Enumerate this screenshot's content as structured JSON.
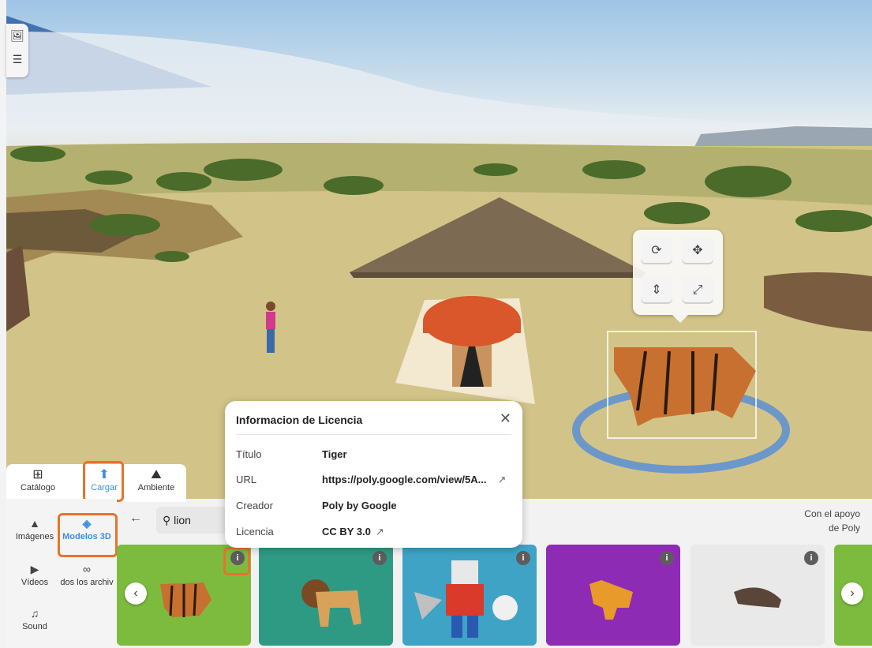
{
  "side_tools": {
    "gallery_icon": "gallery-icon",
    "list_icon": "list-icon"
  },
  "gizmo": {
    "rotate_icon": "rotate-icon",
    "move_icon": "move-icon",
    "height_icon": "height-icon",
    "scale_icon": "scale-icon"
  },
  "tabs": [
    {
      "label": "Catálogo",
      "icon": "⊞"
    },
    {
      "label": "Cargar",
      "icon": "⬆"
    },
    {
      "label": "Ambiente",
      "icon": "⛰"
    }
  ],
  "nav": [
    {
      "label": "Imágenes",
      "icon": "▲"
    },
    {
      "label": "Modelos 3D",
      "icon": "◈"
    },
    {
      "label": "Vídeos",
      "icon": "▶"
    },
    {
      "label": "dos los archiv",
      "icon": "∞"
    },
    {
      "label": "Sound",
      "icon": "♫"
    }
  ],
  "search": {
    "value": "lion"
  },
  "support": {
    "line1": "Con el apoyo",
    "line2": "de Poly"
  },
  "popup": {
    "title": "Informacion de Licencia",
    "close": "✕",
    "rows": [
      {
        "key": "Título",
        "value": "Tiger"
      },
      {
        "key": "URL",
        "value": "https://poly.google.com/view/5A..."
      },
      {
        "key": "Creador",
        "value": "Poly by Google"
      },
      {
        "key": "Licencia",
        "value": "CC BY 3.0"
      }
    ],
    "ext_icon": "↗"
  },
  "cards": [
    {
      "name": "tiger",
      "bg": "#7dbb3f"
    },
    {
      "name": "lion",
      "bg": "#2f9a84"
    },
    {
      "name": "robot",
      "bg": "#3fa3c6"
    },
    {
      "name": "fox",
      "bg": "#8e2bb4"
    },
    {
      "name": "seal",
      "bg": "#e9e9e9"
    },
    {
      "name": "partial",
      "bg": "#7dbb3f"
    }
  ],
  "info_glyph": "i",
  "nav_arrows": {
    "prev": "‹",
    "next": "›",
    "back": "←"
  },
  "colors": {
    "accent": "#3a8ee6",
    "highlight": "#e8732a"
  }
}
